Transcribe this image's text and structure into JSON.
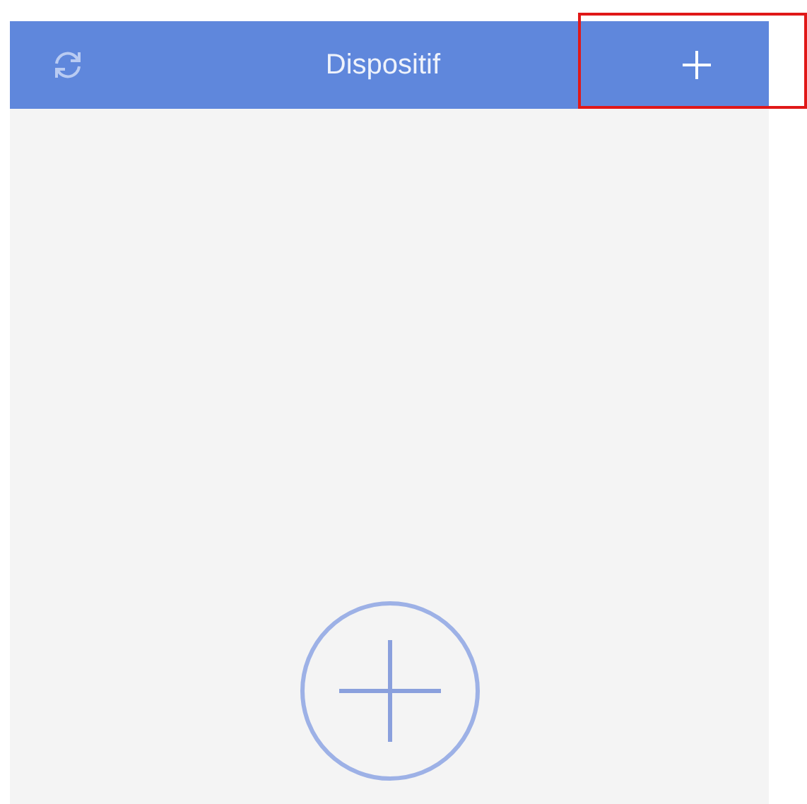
{
  "header": {
    "title": "Dispositif"
  }
}
